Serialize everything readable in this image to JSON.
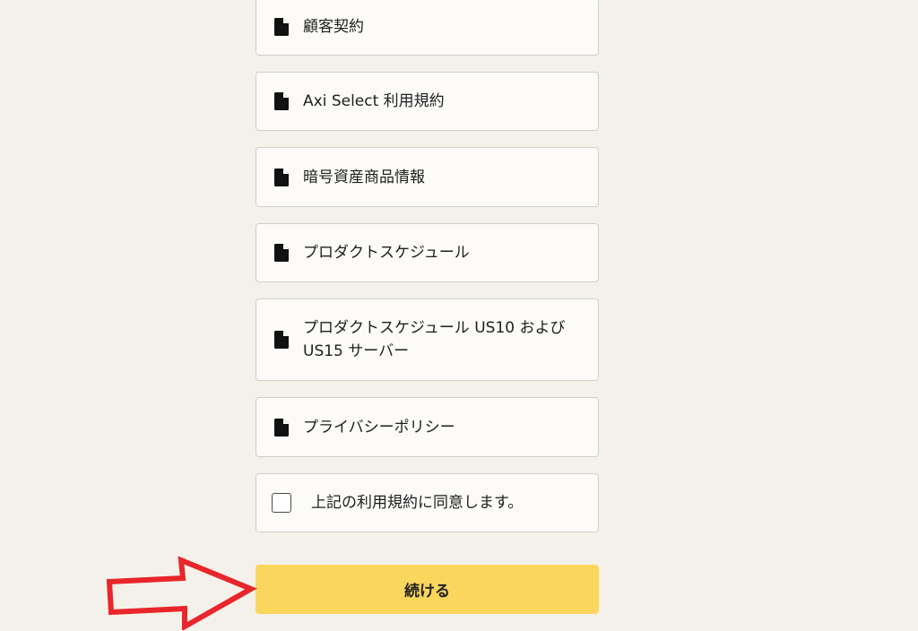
{
  "documents": [
    {
      "label": "顧客契約",
      "icon": "document-icon"
    },
    {
      "label": "Axi Select 利用規約",
      "icon": "document-icon"
    },
    {
      "label": "暗号資産商品情報",
      "icon": "document-icon"
    },
    {
      "label": "プロダクトスケジュール",
      "icon": "document-icon"
    },
    {
      "label_line1": "プロダクトスケジュール US10 および",
      "label_line2": "US15 サーバー",
      "icon": "document-icon"
    },
    {
      "label": "プライバシーポリシー",
      "icon": "document-icon"
    }
  ],
  "agreement": {
    "label": "上記の利用規約に同意します。",
    "checked": false
  },
  "continue_button": {
    "label": "続ける"
  },
  "colors": {
    "background": "#f4f1ea",
    "card": "#fcfbf8",
    "card_border": "#d2cfc8",
    "button": "#fbd65c",
    "annotation_arrow": "#e8262b"
  }
}
